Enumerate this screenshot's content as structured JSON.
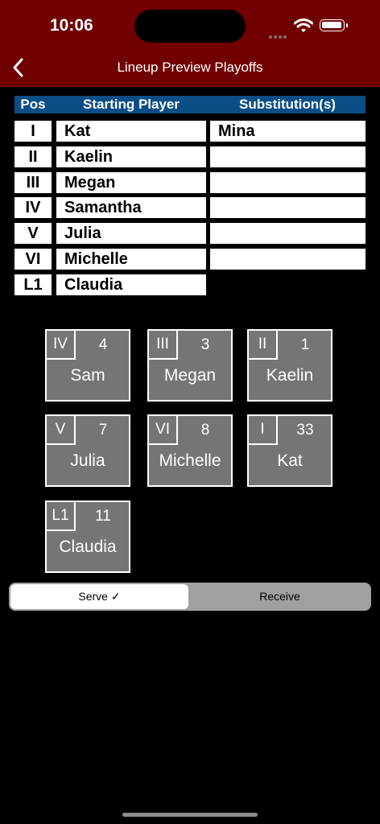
{
  "status_bar": {
    "time": "10:06"
  },
  "nav": {
    "title": "Lineup Preview Playoffs",
    "back_icon": "chevron-left-icon"
  },
  "table": {
    "headers": {
      "pos": "Pos",
      "starting": "Starting Player",
      "subs": "Substitution(s)"
    },
    "rows": [
      {
        "pos": "I",
        "player": "Kat",
        "sub": "Mina"
      },
      {
        "pos": "II",
        "player": "Kaelin",
        "sub": ""
      },
      {
        "pos": "III",
        "player": "Megan",
        "sub": ""
      },
      {
        "pos": "IV",
        "player": "Samantha",
        "sub": ""
      },
      {
        "pos": "V",
        "player": "Julia",
        "sub": ""
      },
      {
        "pos": "VI",
        "player": "Michelle",
        "sub": ""
      },
      {
        "pos": "L1",
        "player": "Claudia"
      }
    ]
  },
  "court": {
    "tiles": [
      {
        "pos": "IV",
        "number": "4",
        "name": "Sam"
      },
      {
        "pos": "III",
        "number": "3",
        "name": "Megan"
      },
      {
        "pos": "II",
        "number": "1",
        "name": "Kaelin"
      },
      {
        "pos": "V",
        "number": "7",
        "name": "Julia"
      },
      {
        "pos": "VI",
        "number": "8",
        "name": "Michelle"
      },
      {
        "pos": "I",
        "number": "33",
        "name": "Kat"
      },
      {
        "pos": "L1",
        "number": "11",
        "name": "Claudia"
      }
    ]
  },
  "segment": {
    "serve": "Serve ✓",
    "receive": "Receive",
    "selected": "serve"
  },
  "colors": {
    "header": "#710000",
    "table_header": "#0b4e86",
    "tile": "#757575"
  }
}
